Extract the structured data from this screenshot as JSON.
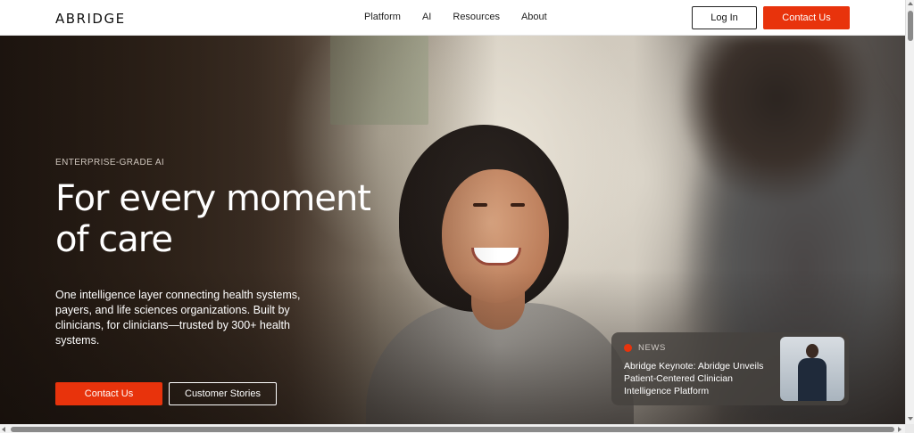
{
  "nav": {
    "logo": "ABRIDGE",
    "links": [
      "Platform",
      "AI",
      "Resources",
      "About"
    ],
    "login_label": "Log In",
    "contact_label": "Contact Us"
  },
  "hero": {
    "eyebrow": "ENTERPRISE-GRADE AI",
    "headline": "For every moment of care",
    "subcopy": "One intelligence layer connecting health systems, payers, and life sciences organizations. Built by clinicians, for clinicians—trusted by 300+ health systems.",
    "primary_cta": "Contact Us",
    "secondary_cta": "Customer Stories"
  },
  "news": {
    "label": "NEWS",
    "title": "Abridge Keynote: Abridge Unveils Patient-Centered Clinician Intelligence Platform"
  },
  "colors": {
    "accent": "#e8330c",
    "nav_bg": "#ffffff",
    "text_dark": "#111111"
  }
}
